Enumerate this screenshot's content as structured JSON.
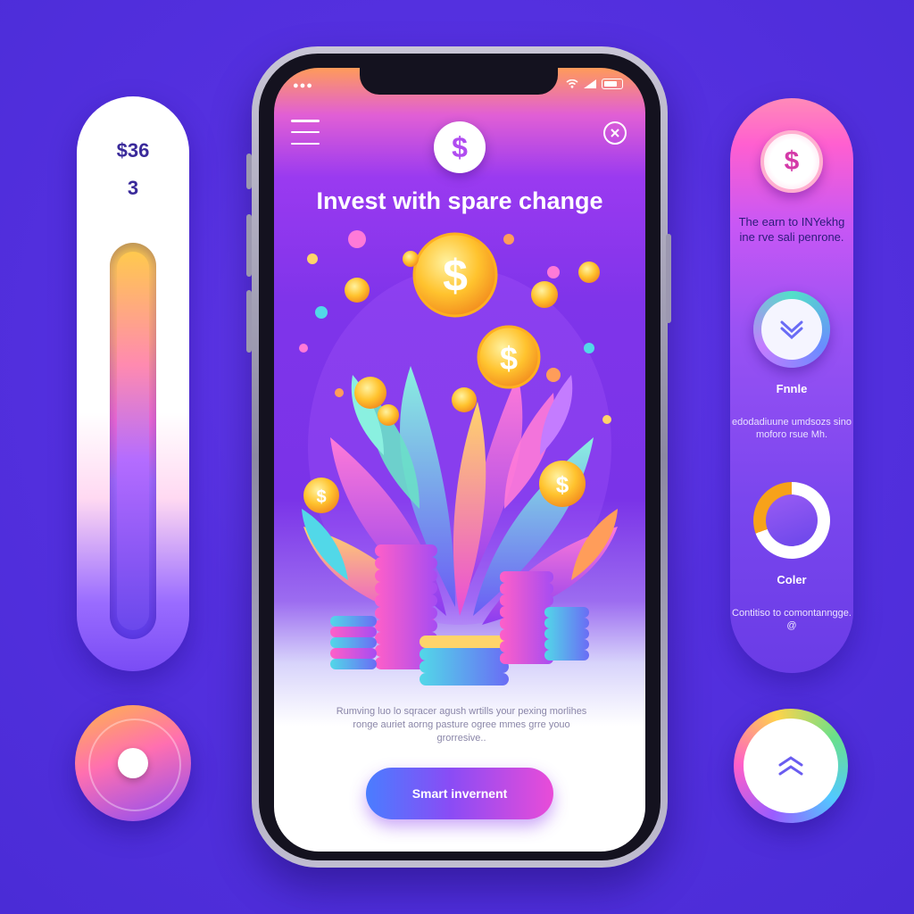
{
  "left_panel": {
    "price": "$36",
    "quantity": "3",
    "slider_level": 0.0
  },
  "phone": {
    "status_bar": {
      "left_dots": "●●●",
      "wifi_icon": "wifi-icon",
      "signal_icon": "signal-icon",
      "battery_icon": "battery-icon"
    },
    "header": {
      "menu_icon": "hamburger-menu-icon",
      "logo_symbol": "$",
      "close_icon": "close-icon"
    },
    "headline": "Invest with spare change",
    "body_text": "Rumving luo lo sqracer agush wrtills your pexing morlihes ronge auriet aorng pasture ogree mmes grre youo grorresive..",
    "cta_label": "Smart invernent"
  },
  "right_panel": {
    "coin_symbol": "$",
    "text_1": "The earn to INYekhg ine rve sali penrone.",
    "chevron_icon": "chevron-down-icon",
    "label_1": "Fnnle",
    "text_2": "edodadiuune umdsozs sino moforo rsue Mh.",
    "label_2": "Coler",
    "text_3": "Contitiso to comontanngge. @",
    "knob_icon": "chevron-up-icon"
  },
  "colors": {
    "background": "#5530e0",
    "accent_purple": "#8a4cf5",
    "accent_pink": "#e94cd8",
    "accent_gold": "#f7b52a",
    "accent_teal": "#52e0c8"
  }
}
